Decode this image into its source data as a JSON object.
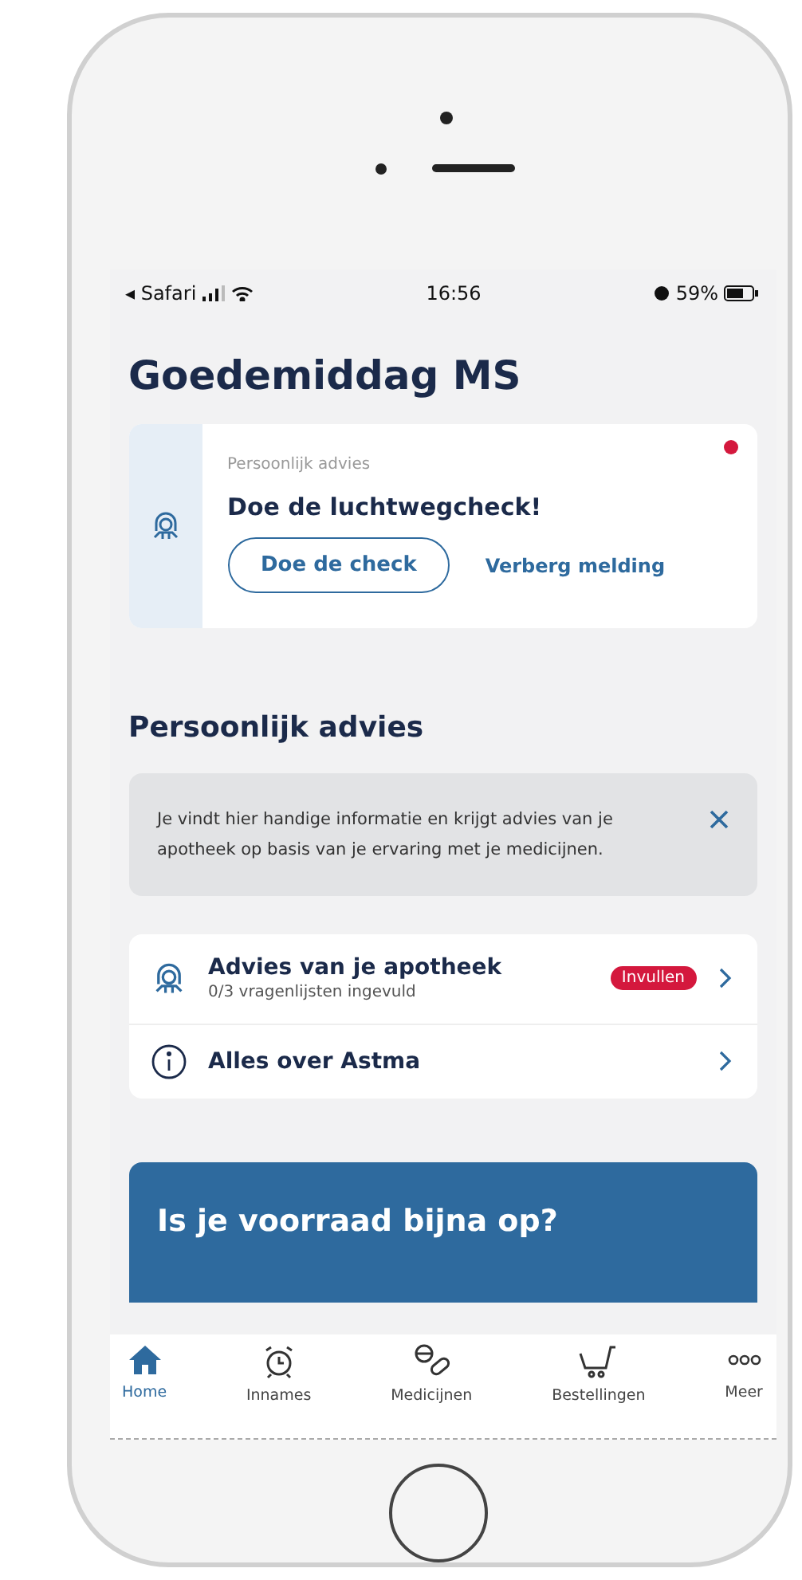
{
  "status_bar": {
    "back_label": "◂ Safari",
    "time": "16:56",
    "battery": "59%"
  },
  "greeting": "Goedemiddag MS",
  "notification": {
    "unread": true,
    "category": "Persoonlijk advies",
    "title": "Doe de luchtwegcheck!",
    "primary_button": "Doe de check",
    "secondary_link": "Verberg melding"
  },
  "section_title": "Persoonlijk advies",
  "info_banner": {
    "text": "Je vindt hier handige informatie en krijgt advies van je apotheek op basis van je ervaring met je medicijnen."
  },
  "advice_items": [
    {
      "kind": "advice",
      "title": "Advies van je apotheek",
      "subtitle": "0/3 vragenlijsten ingevuld",
      "badge": "Invullen"
    },
    {
      "kind": "info",
      "title": "Alles over Astma"
    }
  ],
  "promo_card": {
    "title": "Is je voorraad bijna op?"
  },
  "tab_bar": [
    {
      "kind": "home",
      "label": "Home",
      "selected": true
    },
    {
      "kind": "alarm",
      "label": "Innames",
      "selected": false
    },
    {
      "kind": "pills",
      "label": "Medicijnen",
      "selected": false
    },
    {
      "kind": "cart",
      "label": "Bestellingen",
      "selected": false
    },
    {
      "kind": "more",
      "label": "Meer",
      "selected": false
    }
  ]
}
